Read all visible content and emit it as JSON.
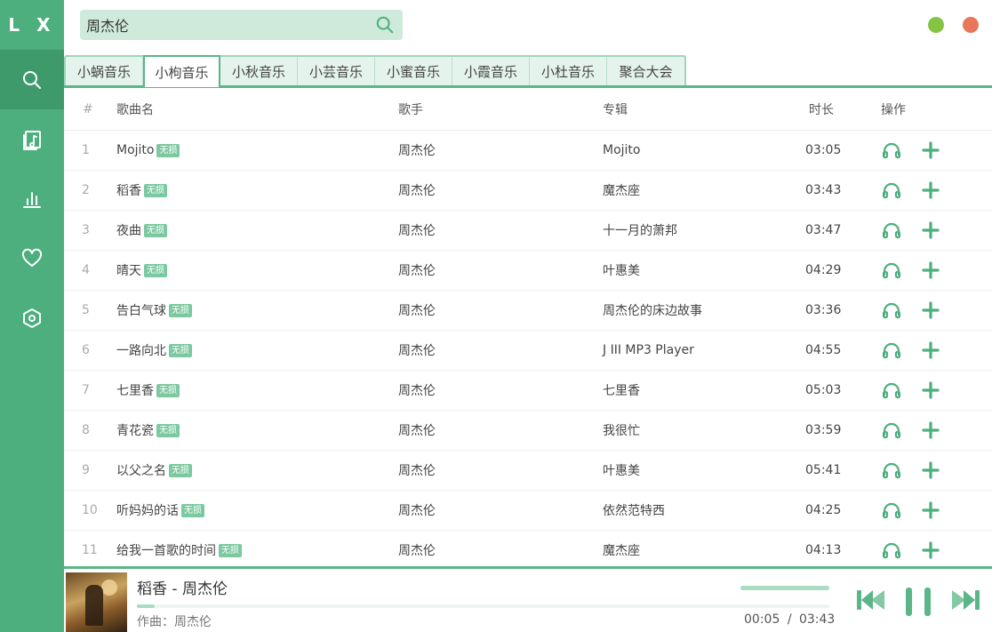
{
  "app": {
    "logo": "L X"
  },
  "sidebar": {
    "items": [
      {
        "icon": "search-icon",
        "active": true
      },
      {
        "icon": "music-list-icon",
        "active": false
      },
      {
        "icon": "chart-icon",
        "active": false
      },
      {
        "icon": "heart-icon",
        "active": false
      },
      {
        "icon": "settings-icon",
        "active": false
      }
    ]
  },
  "search": {
    "value": "周杰伦",
    "placeholder": ""
  },
  "tabs": [
    "小蜗音乐",
    "小枸音乐",
    "小秋音乐",
    "小芸音乐",
    "小蜜音乐",
    "小霞音乐",
    "小杜音乐",
    "聚合大会"
  ],
  "active_tab_index": 1,
  "table": {
    "headers": {
      "idx": "#",
      "name": "歌曲名",
      "singer": "歌手",
      "album": "专辑",
      "duration": "时长",
      "ops": "操作"
    },
    "rows": [
      {
        "idx": "1",
        "name": "Mojito",
        "badge": "无损",
        "singer": "周杰伦",
        "album": "Mojito",
        "duration": "03:05"
      },
      {
        "idx": "2",
        "name": "稻香",
        "badge": "无损",
        "singer": "周杰伦",
        "album": "魔杰座",
        "duration": "03:43"
      },
      {
        "idx": "3",
        "name": "夜曲",
        "badge": "无损",
        "singer": "周杰伦",
        "album": "十一月的萧邦",
        "duration": "03:47"
      },
      {
        "idx": "4",
        "name": "晴天",
        "badge": "无损",
        "singer": "周杰伦",
        "album": "叶惠美",
        "duration": "04:29"
      },
      {
        "idx": "5",
        "name": "告白气球",
        "badge": "无损",
        "singer": "周杰伦",
        "album": "周杰伦的床边故事",
        "duration": "03:36"
      },
      {
        "idx": "6",
        "name": "一路向北",
        "badge": "无损",
        "singer": "周杰伦",
        "album": "J III MP3 Player",
        "duration": "04:55"
      },
      {
        "idx": "7",
        "name": "七里香",
        "badge": "无损",
        "singer": "周杰伦",
        "album": "七里香",
        "duration": "05:03"
      },
      {
        "idx": "8",
        "name": "青花瓷",
        "badge": "无损",
        "singer": "周杰伦",
        "album": "我很忙",
        "duration": "03:59"
      },
      {
        "idx": "9",
        "name": "以父之名",
        "badge": "无损",
        "singer": "周杰伦",
        "album": "叶惠美",
        "duration": "05:41"
      },
      {
        "idx": "10",
        "name": "听妈妈的话",
        "badge": "无损",
        "singer": "周杰伦",
        "album": "依然范特西",
        "duration": "04:25"
      },
      {
        "idx": "11",
        "name": "给我一首歌的时间",
        "badge": "无损",
        "singer": "周杰伦",
        "album": "魔杰座",
        "duration": "04:13"
      }
    ]
  },
  "player": {
    "title": "稻香 - 周杰伦",
    "composer": "作曲：周杰伦",
    "current_time": "00:05",
    "separator": "/",
    "total_time": "03:43",
    "progress_fraction": 0.026,
    "volume_fraction": 1.0
  },
  "colors": {
    "accent": "#4caf7d",
    "accent_dark": "#3f9a6b",
    "minimize": "#85c442",
    "close": "#e8775a"
  }
}
